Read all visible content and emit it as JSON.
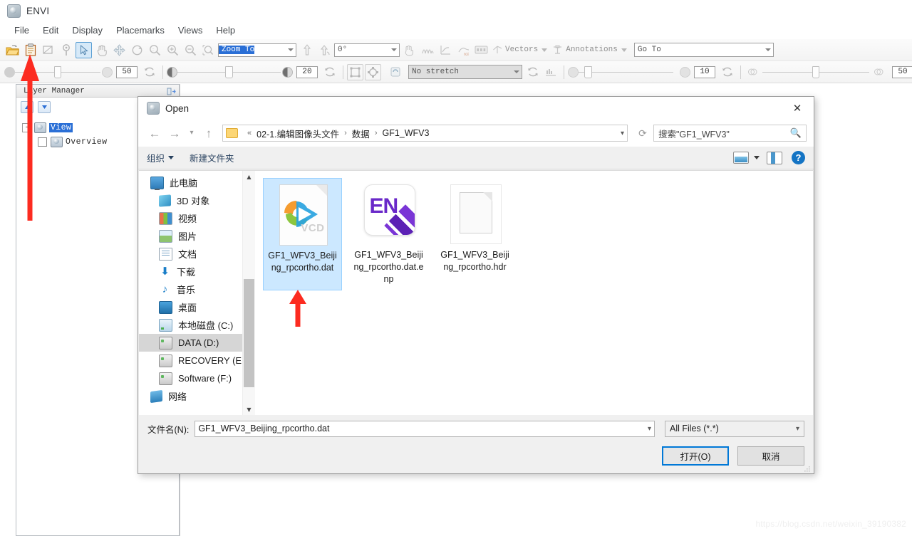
{
  "app": {
    "title": "ENVI",
    "app_icon": "envi-logo-icon",
    "menu": [
      "File",
      "Edit",
      "Display",
      "Placemarks",
      "Views",
      "Help"
    ]
  },
  "toolbar_row1": {
    "icons": [
      "open-folder-icon",
      "clipboard-icon",
      "crop-icon",
      "pin-icon",
      "cursor-select-icon",
      "pan-hand-icon",
      "fly-move-icon",
      "rotate-icon",
      "zoom-fit-icon",
      "zoom-in-icon",
      "zoom-out-icon",
      "zoom-region-icon"
    ],
    "zoom_combo_value": "Zoom To",
    "zoom_combo_selected": true,
    "north-up-icon": "north-up-icon",
    "rotate-north-icon": "rotate-north-icon",
    "rotation_value": "0°",
    "right_icons": [
      "cursor-value-icon",
      "spectral-profile-icon",
      "plot-profile-icon",
      "roi-tool-icon",
      "band-ratio-icon"
    ],
    "vectors_label": "Vectors",
    "annotations_label": "Annotations",
    "goto_placeholder": "Go To"
  },
  "toolbar_row2": {
    "transparency_value": "50",
    "brightness_value": "20",
    "stretch_value": "No stretch",
    "sharpen_value": "10",
    "blend_value": "50",
    "icons": [
      "reset-icon",
      "contrast-icon",
      "fit-to-window-icon",
      "actual-size-icon",
      "refresh-icon",
      "stretch-refresh-icon",
      "histogram-icon",
      "measure-icon",
      "screenshot-icon",
      "single-view-icon",
      "stacked-view-icon",
      "split-view-icon"
    ]
  },
  "layer_manager": {
    "title": "Layer Manager",
    "pin_icon": "pin-panel-icon",
    "up_icon": "move-up-icon",
    "down_icon": "move-down-icon",
    "tree": {
      "root_label": "View",
      "root_selected": true,
      "child_label": "Overview",
      "child_checked": false,
      "expander": "-"
    }
  },
  "dialog": {
    "title": "Open",
    "icon": "envi-logo-icon",
    "close_icon": "close-icon",
    "nav": {
      "back_icon": "back-arrow-icon",
      "forward_icon": "forward-arrow-icon",
      "recent_icon": "recent-dropdown-icon",
      "up_icon": "up-arrow-icon",
      "folder_icon": "folder-icon",
      "breadcrumb_prefix": "«",
      "breadcrumbs": [
        "02-1.编辑图像头文件",
        "数据",
        "GF1_WFV3"
      ],
      "breadcrumb_separator": "›",
      "dropdown_icon": "chevron-down-icon",
      "refresh_icon": "refresh-icon"
    },
    "search": {
      "placeholder": "搜索\"GF1_WFV3\"",
      "icon": "search-icon"
    },
    "commandbar": {
      "organize_label": "组织",
      "new_folder_label": "新建文件夹",
      "view_icon": "view-mode-icon",
      "view_caret_icon": "chevron-down-icon",
      "preview_icon": "preview-pane-icon",
      "help_icon": "help-icon"
    },
    "nav_pane": {
      "items": [
        {
          "label": "此电脑",
          "icon": "this-pc-icon",
          "indent": false,
          "selected": false
        },
        {
          "label": "3D 对象",
          "icon": "3d-objects-icon",
          "indent": true,
          "selected": false
        },
        {
          "label": "视频",
          "icon": "videos-icon",
          "indent": true,
          "selected": false
        },
        {
          "label": "图片",
          "icon": "pictures-icon",
          "indent": true,
          "selected": false
        },
        {
          "label": "文档",
          "icon": "documents-icon",
          "indent": true,
          "selected": false
        },
        {
          "label": "下载",
          "icon": "downloads-icon",
          "indent": true,
          "selected": false
        },
        {
          "label": "音乐",
          "icon": "music-icon",
          "indent": true,
          "selected": false
        },
        {
          "label": "桌面",
          "icon": "desktop-icon",
          "indent": true,
          "selected": false
        },
        {
          "label": "本地磁盘 (C:)",
          "icon": "local-disk-icon",
          "indent": true,
          "selected": false
        },
        {
          "label": "DATA (D:)",
          "icon": "drive-icon",
          "indent": true,
          "selected": true
        },
        {
          "label": "RECOVERY (E:)",
          "icon": "drive-icon",
          "indent": true,
          "selected": false
        },
        {
          "label": "Software (F:)",
          "icon": "drive-icon",
          "indent": true,
          "selected": false
        },
        {
          "label": "网络",
          "icon": "network-icon",
          "indent": false,
          "selected": false
        }
      ],
      "scroll_up_icon": "scroll-up-icon",
      "scroll_down_icon": "scroll-down-icon"
    },
    "files": [
      {
        "name": "GF1_WFV3_Beijing_rpcortho.dat",
        "thumb": "video-vcd-icon",
        "badge": "VCD",
        "selected": true
      },
      {
        "name": "GF1_WFV3_Beijing_rpcortho.dat.enp",
        "thumb": "endnote-en-icon",
        "badge": "EN",
        "selected": false
      },
      {
        "name": "GF1_WFV3_Beijing_rpcortho.hdr",
        "thumb": "blank-document-icon",
        "badge": "",
        "selected": false
      }
    ],
    "footer": {
      "filename_label": "文件名(N):",
      "filename_value": "GF1_WFV3_Beijing_rpcortho.dat",
      "filter_value": "All Files (*.*)",
      "open_button": "打开(O)",
      "cancel_button": "取消",
      "chevron_icon": "chevron-down-icon",
      "resize_grip_icon": "resize-grip-icon"
    }
  },
  "annotations": {
    "arrow_color": "#fc2b20",
    "arrow_open_toolbar": "red-arrow-pointing-to-open-button",
    "arrow_selected_file": "red-arrow-pointing-to-selected-file"
  },
  "watermark": "https://blog.csdn.net/weixin_39190382"
}
